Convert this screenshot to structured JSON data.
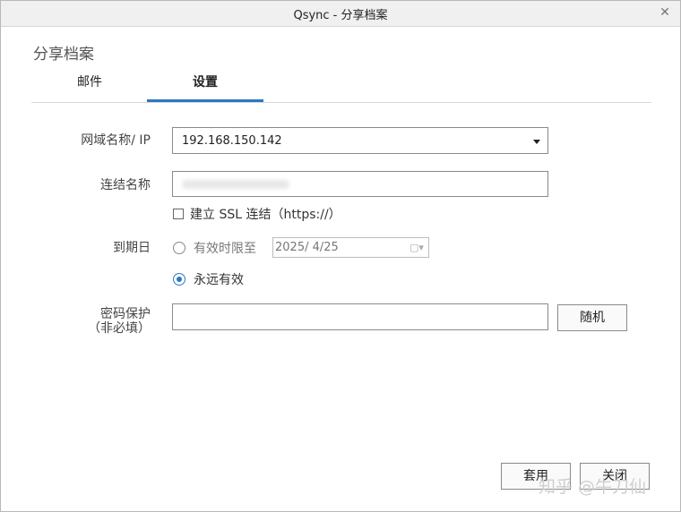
{
  "window": {
    "title": "Qsync - 分享档案"
  },
  "section_title": "分享档案",
  "tabs": [
    {
      "label": "邮件",
      "active": false
    },
    {
      "label": "设置",
      "active": true
    }
  ],
  "form": {
    "domain": {
      "label": "网域名称/ IP",
      "value": "192.168.150.142"
    },
    "link_name": {
      "label": "连结名称"
    },
    "ssl": {
      "label": "建立 SSL 连结（https://）",
      "checked": false
    },
    "expiry": {
      "label": "到期日",
      "option_until": "有效时限至",
      "date": "2025/  4/25",
      "option_forever": "永远有效",
      "selected": "forever"
    },
    "password": {
      "label_line1": "密码保护",
      "label_line2": "（非必填）",
      "random_label": "随机"
    }
  },
  "footer": {
    "apply_label": "套用",
    "close_label": "关闭"
  },
  "watermark": "知乎 @牛刀仙",
  "colors": {
    "accent": "#2b78c2"
  }
}
